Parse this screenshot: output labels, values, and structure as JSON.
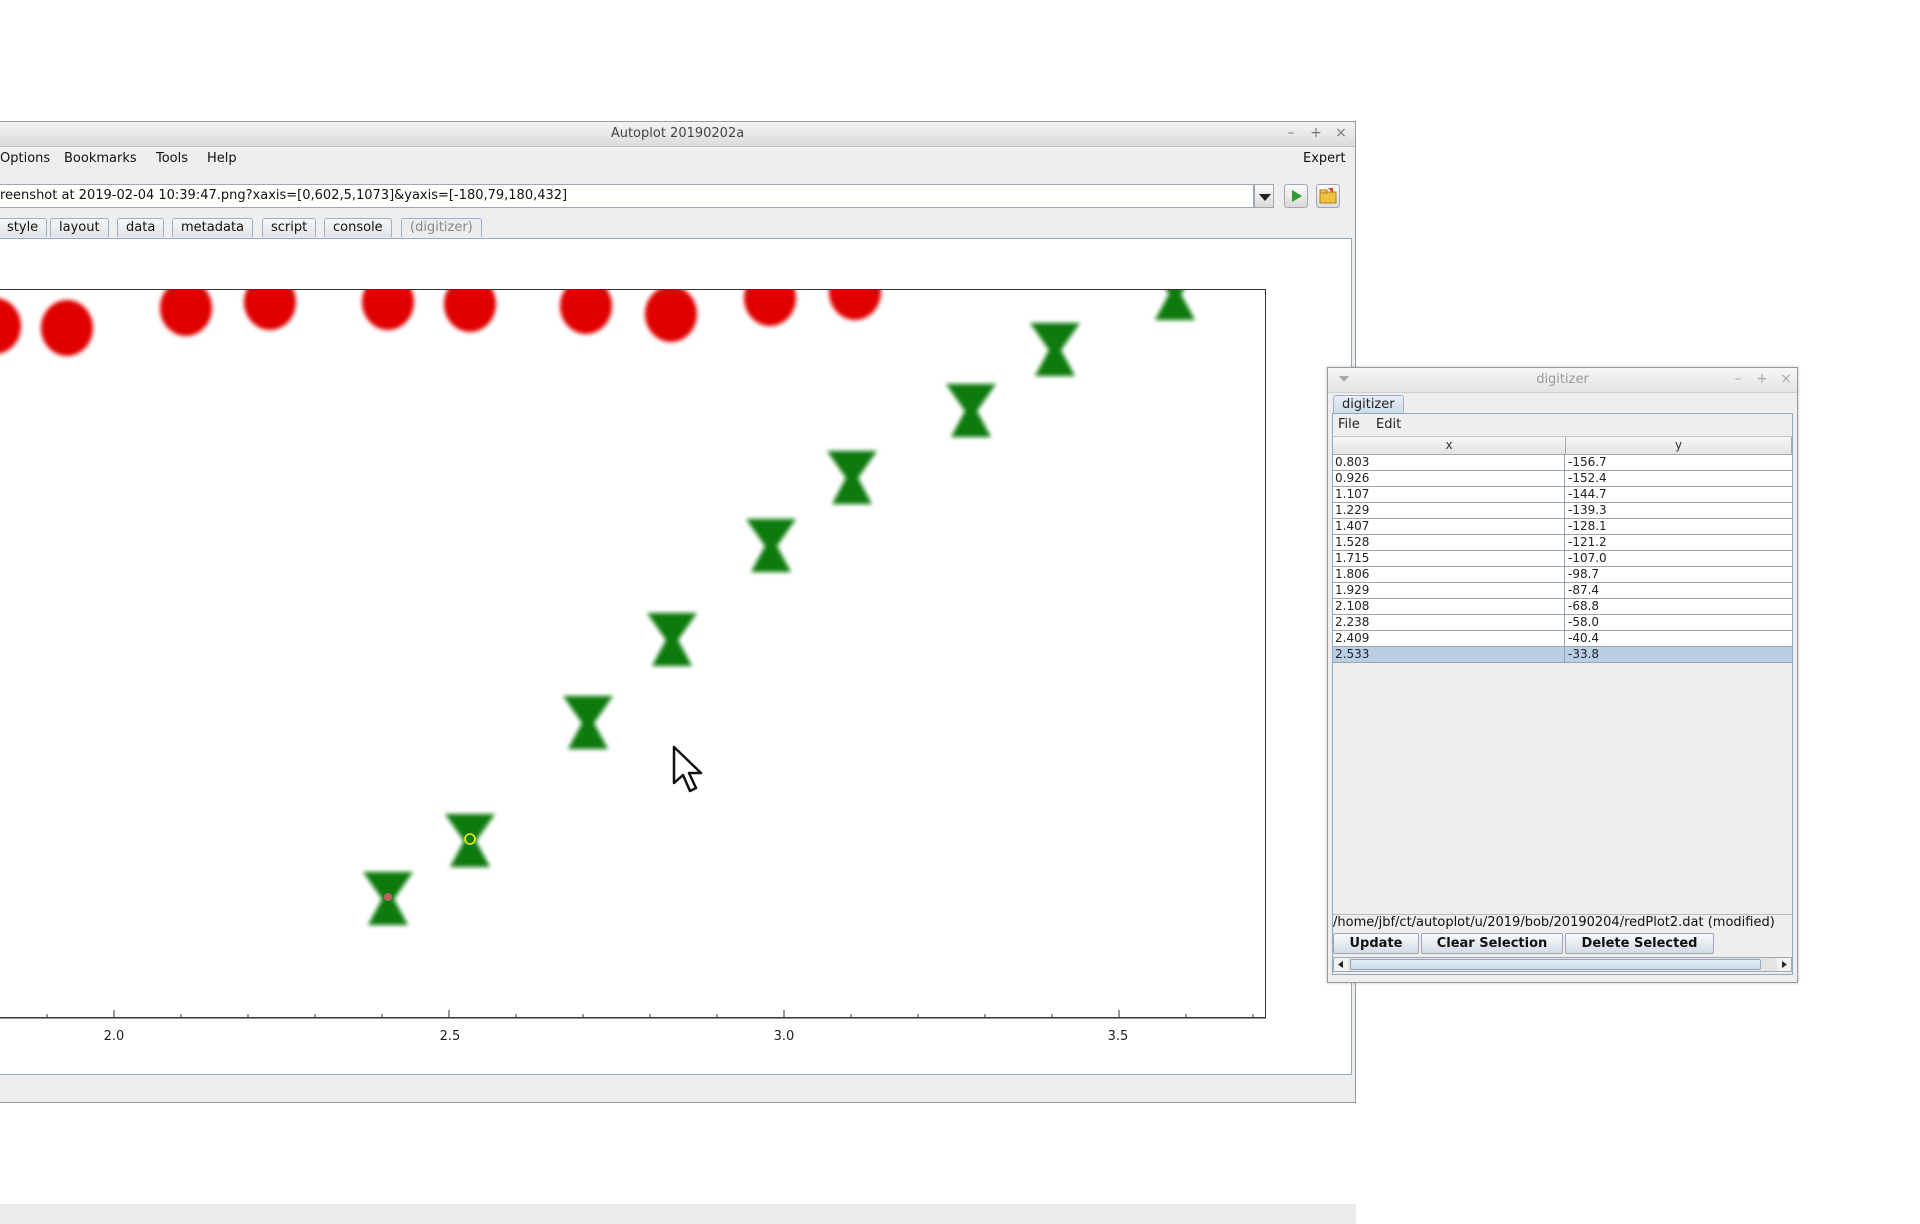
{
  "main_window": {
    "title": "Autoplot 20190202a",
    "window_controls": {
      "minimize": "–",
      "maximize": "+",
      "close": "×"
    },
    "menu": [
      "Options",
      "Bookmarks",
      "Tools",
      "Help"
    ],
    "expert_label": "Expert",
    "uri": "reenshot at 2019-02-04 10:39:47.png?xaxis=[0,602,5,1073]&yaxis=[-180,79,180,432]",
    "tabs": [
      "style",
      "layout",
      "data",
      "metadata",
      "script",
      "console",
      "(digitizer)"
    ],
    "toolbar_icons": [
      "go-icon",
      "open-folder-icon"
    ]
  },
  "plot": {
    "x_ticks": [
      "2.0",
      "2.5",
      "3.0",
      "3.5"
    ],
    "marker_colors": {
      "red": "#e00000",
      "green": "#0f7a0f"
    }
  },
  "digitizer": {
    "title": "digitizer",
    "window_controls": {
      "minimize": "–",
      "maximize": "+",
      "close": "×"
    },
    "tab": "digitizer",
    "menu": [
      "File",
      "Edit"
    ],
    "columns": [
      "x",
      "y"
    ],
    "rows": [
      {
        "x": "0.803",
        "y": "-156.7"
      },
      {
        "x": "0.926",
        "y": "-152.4"
      },
      {
        "x": "1.107",
        "y": "-144.7"
      },
      {
        "x": "1.229",
        "y": "-139.3"
      },
      {
        "x": "1.407",
        "y": "-128.1"
      },
      {
        "x": "1.528",
        "y": "-121.2"
      },
      {
        "x": "1.715",
        "y": "-107.0"
      },
      {
        "x": "1.806",
        "y": "-98.7"
      },
      {
        "x": "1.929",
        "y": "-87.4"
      },
      {
        "x": "2.108",
        "y": "-68.8"
      },
      {
        "x": "2.238",
        "y": "-58.0"
      },
      {
        "x": "2.409",
        "y": "-40.4"
      },
      {
        "x": "2.533",
        "y": "-33.8"
      }
    ],
    "selected_row": 12,
    "file_path": "/home/jbf/ct/autoplot/u/2019/bob/20190204/redPlot2.dat (modified)",
    "buttons": {
      "update": "Update",
      "clear_selection": "Clear Selection",
      "delete_selected": "Delete Selected"
    }
  }
}
